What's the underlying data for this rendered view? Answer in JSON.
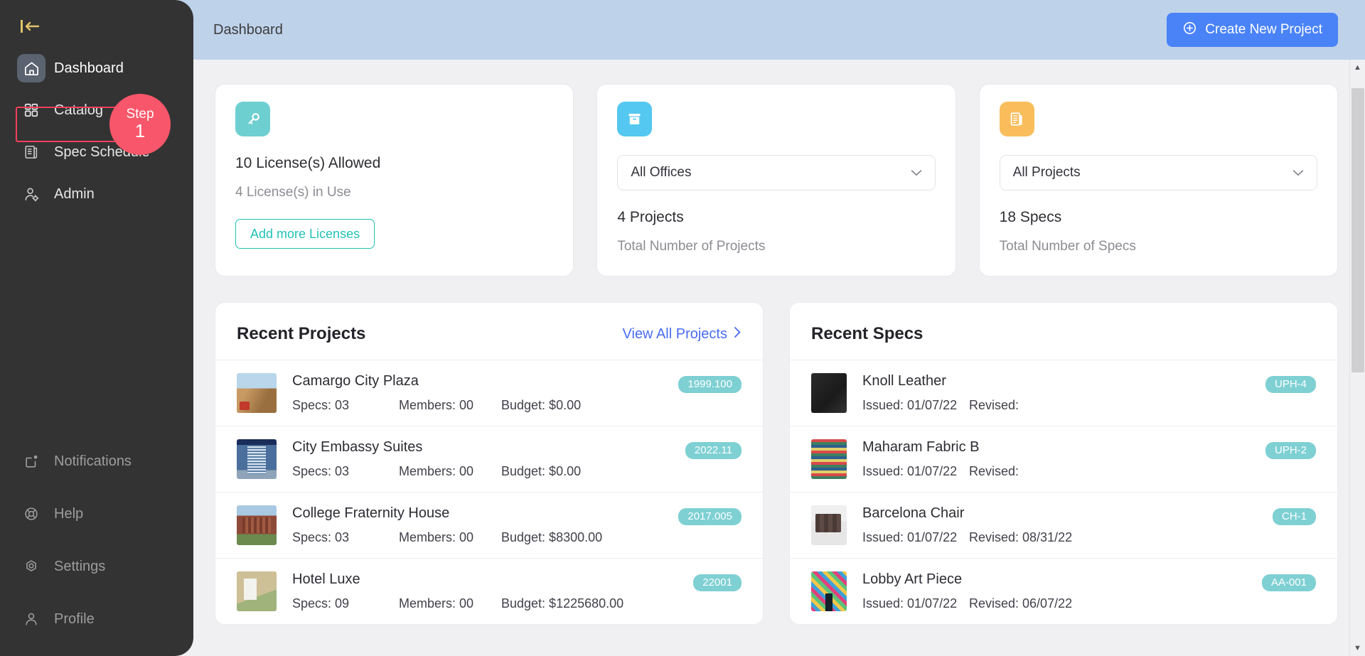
{
  "colors": {
    "sidebar_bg": "#333333",
    "header_bg": "#bed2ea",
    "accent_blue": "#4a83f7",
    "accent_teal": "#21c2b6",
    "badge_teal": "#7ed0d3",
    "step_red": "#f8566a",
    "highlight_red": "#f0415a",
    "page_bg": "#f0f0f2"
  },
  "sidebar": {
    "collapse_icon": "collapse-sidebar-icon",
    "top_items": [
      {
        "label": "Dashboard",
        "icon": "home-icon",
        "active": true
      },
      {
        "label": "Catalog",
        "icon": "grid-icon",
        "active": false
      },
      {
        "label": "Spec Schedule",
        "icon": "list-document-icon",
        "active": false
      },
      {
        "label": "Admin",
        "icon": "user-gear-icon",
        "active": false
      }
    ],
    "bottom_items": [
      {
        "label": "Notifications",
        "icon": "notification-bell-icon"
      },
      {
        "label": "Help",
        "icon": "lifebuoy-icon"
      },
      {
        "label": "Settings",
        "icon": "gear-icon"
      },
      {
        "label": "Profile",
        "icon": "person-icon"
      }
    ]
  },
  "tutorial": {
    "step_word": "Step",
    "step_number": "1",
    "target": "Catalog"
  },
  "header": {
    "title": "Dashboard",
    "create_button": "Create New Project",
    "create_icon": "plus-circle-icon"
  },
  "stats": {
    "license_card": {
      "icon": "key-icon",
      "allowed": "10 License(s) Allowed",
      "in_use": "4 License(s) in Use",
      "button": "Add more Licenses"
    },
    "projects_card": {
      "icon": "archive-box-icon",
      "select_value": "All Offices",
      "count": "4 Projects",
      "caption": "Total Number of Projects"
    },
    "specs_card": {
      "icon": "spec-document-icon",
      "select_value": "All Projects",
      "count": "18 Specs",
      "caption": "Total Number of Specs"
    }
  },
  "recent_projects": {
    "title": "Recent Projects",
    "view_all": "View All Projects",
    "view_all_icon": "chevron-right-icon",
    "labels": {
      "specs": "Specs:",
      "members": "Members:",
      "budget": "Budget:"
    },
    "rows": [
      {
        "name": "Camargo City Plaza",
        "specs": "Specs: 03",
        "members": "Members: 00",
        "budget": "Budget: $0.00",
        "badge": "1999.100",
        "thumb": "t-plaza"
      },
      {
        "name": "City Embassy Suites",
        "specs": "Specs: 03",
        "members": "Members: 00",
        "budget": "Budget: $0.00",
        "badge": "2022.11",
        "thumb": "t-embassy"
      },
      {
        "name": "College Fraternity House",
        "specs": "Specs: 03",
        "members": "Members: 00",
        "budget": "Budget: $8300.00",
        "badge": "2017.005",
        "thumb": "t-college"
      },
      {
        "name": "Hotel Luxe",
        "specs": "Specs: 09",
        "members": "Members: 00",
        "budget": "Budget: $1225680.00",
        "badge": "22001",
        "thumb": "t-hotel"
      }
    ]
  },
  "recent_specs": {
    "title": "Recent Specs",
    "rows": [
      {
        "name": "Knoll Leather",
        "issued": "Issued: 01/07/22",
        "revised": "Revised:",
        "badge": "UPH-4",
        "thumb": "t-leather"
      },
      {
        "name": "Maharam Fabric B",
        "issued": "Issued: 01/07/22",
        "revised": "Revised:",
        "badge": "UPH-2",
        "thumb": "t-fabric"
      },
      {
        "name": "Barcelona Chair",
        "issued": "Issued: 01/07/22",
        "revised": "Revised: 08/31/22",
        "badge": "CH-1",
        "thumb": "t-chair"
      },
      {
        "name": "Lobby Art Piece",
        "issued": "Issued: 01/07/22",
        "revised": "Revised: 06/07/22",
        "badge": "AA-001",
        "thumb": "t-art"
      }
    ]
  },
  "scrollbar": {
    "up": "▲",
    "down": "▼"
  }
}
